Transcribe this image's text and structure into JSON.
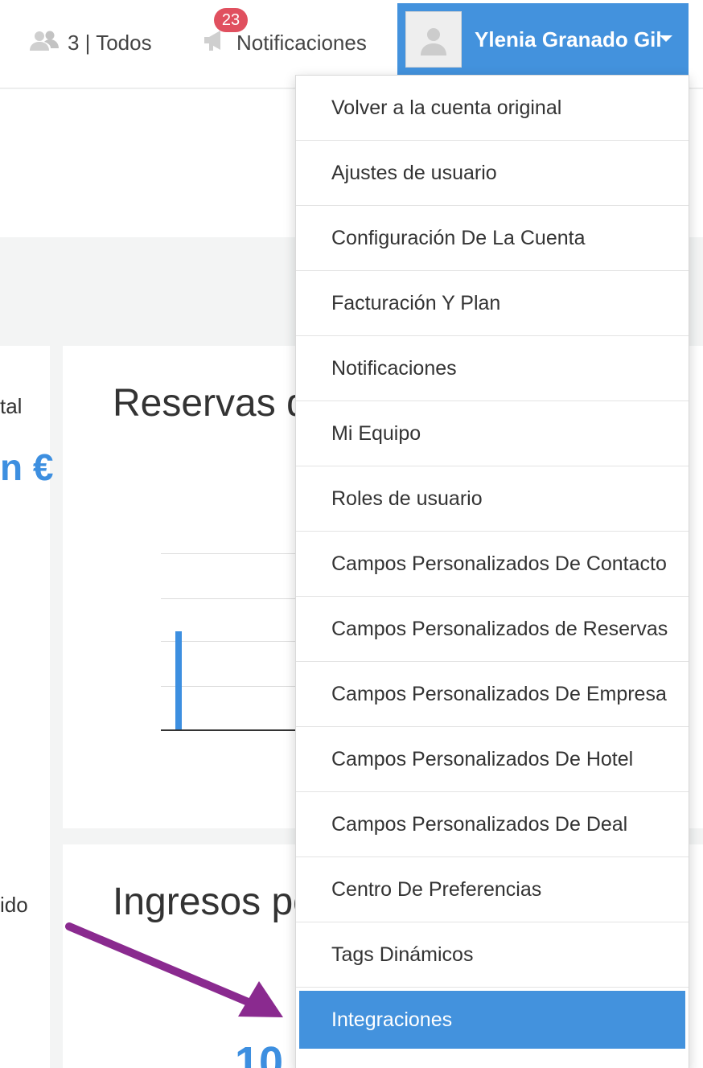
{
  "header": {
    "users_label": "3 | Todos",
    "notifications_label": "Notificaciones",
    "notifications_count": "23",
    "user_name": "Ylenia Granado Gil",
    "users_icon": "users-icon",
    "notifications_icon": "megaphone-icon",
    "avatar_icon": "user-avatar-icon",
    "dropdown_icon": "caret-down-icon"
  },
  "background": {
    "left_fragment_1": "tal",
    "left_fragment_2": "n €",
    "left_fragment_3": "ido",
    "card1_title": "Reservas d",
    "card2_title": "Ingresos po",
    "card2_value": "10"
  },
  "dropdown": {
    "items": [
      {
        "label": "Volver a la cuenta original"
      },
      {
        "label": "Ajustes de usuario"
      },
      {
        "label": "Configuración De La Cuenta"
      },
      {
        "label": "Facturación Y Plan"
      },
      {
        "label": "Notificaciones"
      },
      {
        "label": "Mi Equipo"
      },
      {
        "label": "Roles de usuario"
      },
      {
        "label": "Campos Personalizados De Contacto"
      },
      {
        "label": "Campos Personalizados de Reservas"
      },
      {
        "label": "Campos Personalizados De Empresa"
      },
      {
        "label": "Campos Personalizados De Hotel"
      },
      {
        "label": "Campos Personalizados De Deal"
      },
      {
        "label": "Centro De Preferencias"
      },
      {
        "label": "Tags Dinámicos"
      },
      {
        "label": "Integraciones",
        "active": true
      }
    ]
  },
  "colors": {
    "accent": "#4392dd",
    "badge": "#e0505f",
    "annotation_arrow": "#8a2a8f"
  }
}
